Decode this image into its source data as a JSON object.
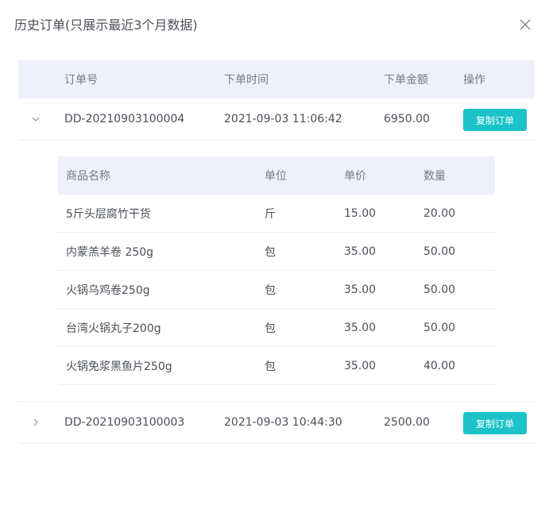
{
  "dialog": {
    "title": "历史订单(只展示最近3个月数据)",
    "close_icon": "close-icon"
  },
  "table": {
    "headers": {
      "order_no": "订单号",
      "order_time": "下单时间",
      "amount": "下单金额",
      "action": "操作"
    },
    "orders": [
      {
        "order_no": "DD-20210903100004",
        "time": "2021-09-03 11:06:42",
        "amount": "6950.00",
        "button": "复制订单",
        "expanded": true,
        "icon": "chevron-down-icon"
      },
      {
        "order_no": "DD-20210903100003",
        "time": "2021-09-03 10:44:30",
        "amount": "2500.00",
        "button": "复制订单",
        "expanded": false,
        "icon": "chevron-right-icon"
      }
    ]
  },
  "detail": {
    "headers": {
      "name": "商品名称",
      "unit": "单位",
      "price": "单价",
      "qty": "数量"
    },
    "items": [
      {
        "name": "5斤头层腐竹干货",
        "unit": "斤",
        "price": "15.00",
        "qty": "20.00"
      },
      {
        "name": "内蒙羔羊卷 250g",
        "unit": "包",
        "price": "35.00",
        "qty": "50.00"
      },
      {
        "name": "火锅乌鸡卷250g",
        "unit": "包",
        "price": "35.00",
        "qty": "50.00"
      },
      {
        "name": "台湾火锅丸子200g",
        "unit": "包",
        "price": "35.00",
        "qty": "50.00"
      },
      {
        "name": "火锅免浆黑鱼片250g",
        "unit": "包",
        "price": "35.00",
        "qty": "40.00"
      }
    ]
  },
  "colors": {
    "accent": "#1bc3c8",
    "header_bg": "#eef1fb"
  }
}
